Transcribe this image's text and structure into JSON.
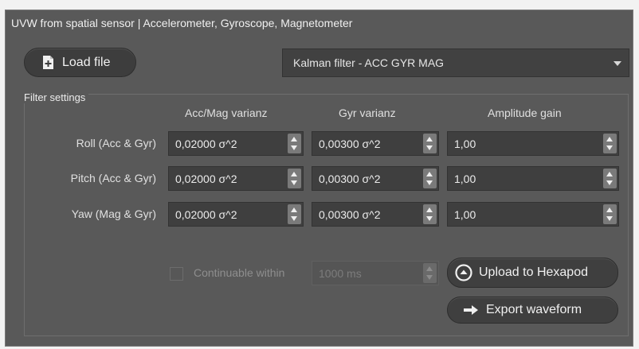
{
  "window": {
    "title": "UVW from spatial sensor | Accelerometer, Gyroscope, Magnetometer"
  },
  "toolbar": {
    "load_file_label": "Load file",
    "filter_select_value": "Kalman filter - ACC GYR MAG"
  },
  "filter_settings": {
    "title": "Filter settings",
    "columns": [
      "Acc/Mag varianz",
      "Gyr varianz",
      "Amplitude gain"
    ],
    "rows": [
      {
        "label": "Roll (Acc & Gyr)",
        "acc_mag": "0,02000 σ^2",
        "gyr": "0,00300 σ^2",
        "gain": "1,00"
      },
      {
        "label": "Pitch (Acc & Gyr)",
        "acc_mag": "0,02000 σ^2",
        "gyr": "0,00300 σ^2",
        "gain": "1,00"
      },
      {
        "label": "Yaw (Mag & Gyr)",
        "acc_mag": "0,02000 σ^2",
        "gyr": "0,00300 σ^2",
        "gain": "1,00"
      }
    ]
  },
  "continuable": {
    "label": "Continuable within",
    "checked": false,
    "value": "1000 ms"
  },
  "actions": {
    "upload_label": "Upload to Hexapod",
    "export_label": "Export waveform"
  },
  "icons": {
    "load": "file-add-icon",
    "upload": "circle-up-arrow-icon",
    "export": "right-arrow-icon"
  }
}
